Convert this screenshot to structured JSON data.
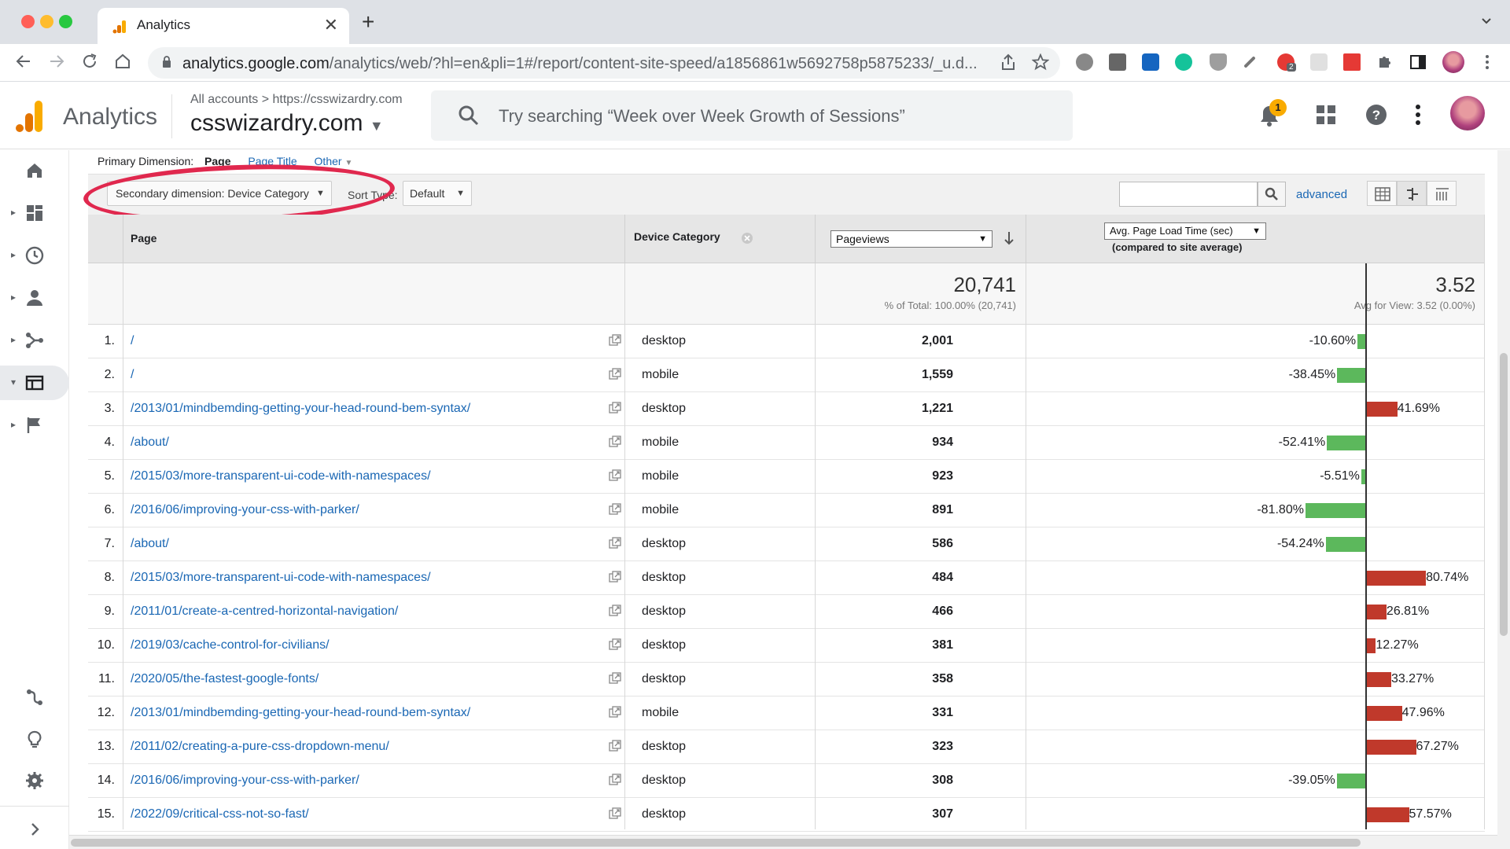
{
  "browser": {
    "tab_title": "Analytics",
    "tab_close": "✕",
    "new_tab": "+",
    "url_host": "analytics.google.com",
    "url_path": "/analytics/web/?hl=en&pli=1#/report/content-site-speed/a1856861w5692758p5875233/_u.d...",
    "ext_badge": "2"
  },
  "header": {
    "app_name": "Analytics",
    "breadcrumb_root": "All accounts",
    "breadcrumb_sep": ">",
    "breadcrumb_site": "https://csswizardry.com",
    "property": "csswizardry.com",
    "search_placeholder": "Try searching “Week over Week Growth of Sessions”",
    "notification_count": "1"
  },
  "report": {
    "primary_dimension_label": "Primary Dimension:",
    "primary_selected": "Page",
    "primary_option_page_title": "Page Title",
    "primary_option_other": "Other",
    "secondary_dimension": "Secondary dimension: Device Category",
    "sort_type_label": "Sort Type:",
    "sort_type_value": "Default",
    "advanced_link": "advanced",
    "columns": {
      "page": "Page",
      "device_category": "Device Category",
      "metric_1": "Pageviews",
      "metric_2": "Avg. Page Load Time (sec)",
      "metric_2_sub": "(compared to site average)"
    },
    "totals": {
      "pageviews": "20,741",
      "pageviews_sub": "% of Total: 100.00% (20,741)",
      "load_time": "3.52",
      "load_time_sub": "Avg for View: 3.52 (0.00%)"
    },
    "rows": [
      {
        "idx": "1.",
        "page": "/",
        "device": "desktop",
        "pageviews": "2,001",
        "pct_label": "-10.60%",
        "pct": -10.6
      },
      {
        "idx": "2.",
        "page": "/",
        "device": "mobile",
        "pageviews": "1,559",
        "pct_label": "-38.45%",
        "pct": -38.45
      },
      {
        "idx": "3.",
        "page": "/2013/01/mindbemding-getting-your-head-round-bem-syntax/",
        "device": "desktop",
        "pageviews": "1,221",
        "pct_label": "41.69%",
        "pct": 41.69
      },
      {
        "idx": "4.",
        "page": "/about/",
        "device": "mobile",
        "pageviews": "934",
        "pct_label": "-52.41%",
        "pct": -52.41
      },
      {
        "idx": "5.",
        "page": "/2015/03/more-transparent-ui-code-with-namespaces/",
        "device": "mobile",
        "pageviews": "923",
        "pct_label": "-5.51%",
        "pct": -5.51
      },
      {
        "idx": "6.",
        "page": "/2016/06/improving-your-css-with-parker/",
        "device": "mobile",
        "pageviews": "891",
        "pct_label": "-81.80%",
        "pct": -81.8
      },
      {
        "idx": "7.",
        "page": "/about/",
        "device": "desktop",
        "pageviews": "586",
        "pct_label": "-54.24%",
        "pct": -54.24
      },
      {
        "idx": "8.",
        "page": "/2015/03/more-transparent-ui-code-with-namespaces/",
        "device": "desktop",
        "pageviews": "484",
        "pct_label": "80.74%",
        "pct": 80.74
      },
      {
        "idx": "9.",
        "page": "/2011/01/create-a-centred-horizontal-navigation/",
        "device": "desktop",
        "pageviews": "466",
        "pct_label": "26.81%",
        "pct": 26.81
      },
      {
        "idx": "10.",
        "page": "/2019/03/cache-control-for-civilians/",
        "device": "desktop",
        "pageviews": "381",
        "pct_label": "12.27%",
        "pct": 12.27
      },
      {
        "idx": "11.",
        "page": "/2020/05/the-fastest-google-fonts/",
        "device": "desktop",
        "pageviews": "358",
        "pct_label": "33.27%",
        "pct": 33.27
      },
      {
        "idx": "12.",
        "page": "/2013/01/mindbemding-getting-your-head-round-bem-syntax/",
        "device": "mobile",
        "pageviews": "331",
        "pct_label": "47.96%",
        "pct": 47.96
      },
      {
        "idx": "13.",
        "page": "/2011/02/creating-a-pure-css-dropdown-menu/",
        "device": "desktop",
        "pageviews": "323",
        "pct_label": "67.27%",
        "pct": 67.27
      },
      {
        "idx": "14.",
        "page": "/2016/06/improving-your-css-with-parker/",
        "device": "desktop",
        "pageviews": "308",
        "pct_label": "-39.05%",
        "pct": -39.05
      },
      {
        "idx": "15.",
        "page": "/2022/09/critical-css-not-so-fast/",
        "device": "desktop",
        "pageviews": "307",
        "pct_label": "57.57%",
        "pct": 57.57
      }
    ]
  },
  "colors": {
    "positive_bar": "#c0392b",
    "negative_bar": "#5cb85c",
    "link": "#1a67b4",
    "highlight_ring": "#e0284e"
  },
  "icons": {
    "nav": [
      "home-icon",
      "dashboard-icon",
      "clock-icon",
      "person-icon",
      "acquisition-icon",
      "behavior-icon",
      "flag-icon"
    ],
    "bottom": [
      "attribution-icon",
      "lightbulb-icon",
      "gear-icon",
      "expand-icon"
    ]
  }
}
